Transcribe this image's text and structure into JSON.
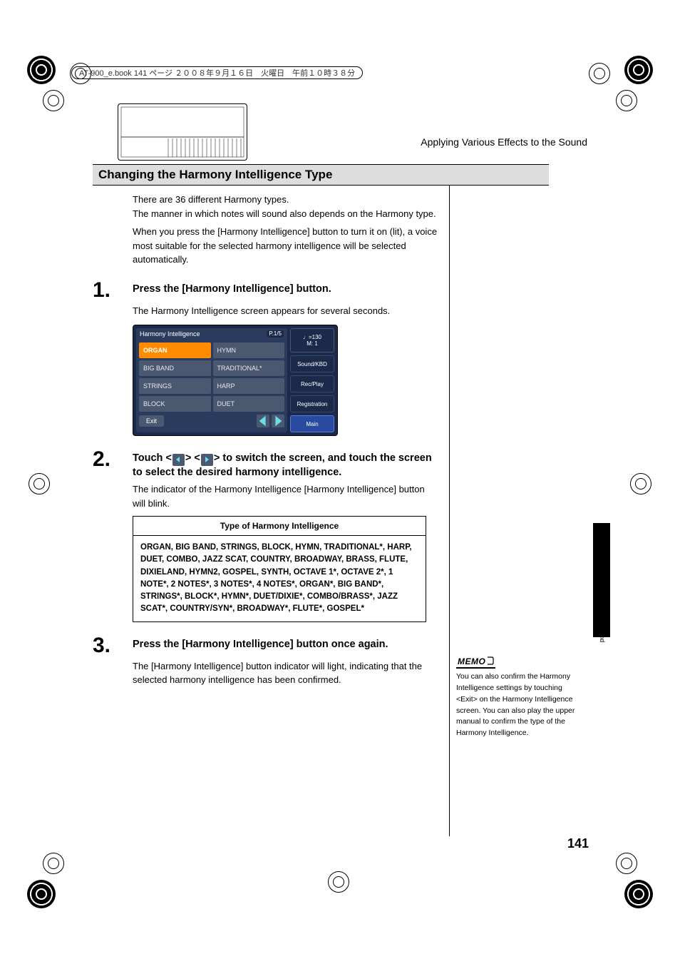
{
  "header": {
    "book_info": "AT-900_e.book  141 ページ  ２００８年９月１６日　火曜日　午前１０時３８分"
  },
  "chapter": "Applying Various Effects to the Sound",
  "section_title": "Changing the Harmony Intelligence Type",
  "intro": {
    "p1": "There are 36 different Harmony types.",
    "p2": "The manner in which notes will sound also depends on the Harmony type.",
    "p3": "When you press the [Harmony Intelligence] button to turn it on (lit), a voice most suitable for the selected harmony intelligence will be selected automatically."
  },
  "steps": {
    "s1": {
      "num": "1.",
      "head": "Press the [Harmony Intelligence] button.",
      "body": "The Harmony Intelligence screen appears for several seconds."
    },
    "s2": {
      "num": "2.",
      "head_pre": "Touch <",
      "head_mid": "> <",
      "head_post": "> to switch the screen, and touch the screen to select the desired harmony intelligence.",
      "body": "The indicator of the Harmony Intelligence [Harmony Intelligence] button will blink."
    },
    "s3": {
      "num": "3.",
      "head": "Press the [Harmony Intelligence] button once again.",
      "body": "The [Harmony Intelligence] button indicator will light, indicating that the selected harmony intelligence has been confirmed."
    }
  },
  "screen": {
    "title": "Harmony Intelligence",
    "page": "P.1/5",
    "cells": [
      "ORGAN",
      "HYMN",
      "BIG BAND",
      "TRADITIONAL*",
      "STRINGS",
      "HARP",
      "BLOCK",
      "DUET"
    ],
    "selected_index": 0,
    "exit": "Exit",
    "tempo_top": "♩=130",
    "tempo_bot": "M:     1",
    "side": [
      "Sound/KBD",
      "Rec/Play",
      "Registration",
      "Main"
    ]
  },
  "table": {
    "header": "Type of Harmony Intelligence",
    "body": "ORGAN, BIG BAND, STRINGS, BLOCK, HYMN, TRADITIONAL*, HARP, DUET, COMBO, JAZZ SCAT, COUNTRY, BROADWAY, BRASS, FLUTE, DIXIELAND, HYMN2, GOSPEL, SYNTH, OCTAVE 1*, OCTAVE 2*, 1 NOTE*, 2 NOTES*, 3 NOTES*, 4 NOTES*, ORGAN*, BIG BAND*, STRINGS*, BLOCK*, HYMN*, DUET/DIXIE*, COMBO/BRASS*, JAZZ SCAT*, COUNTRY/SYN*, BROADWAY*, FLUTE*, GOSPEL*"
  },
  "memo": {
    "label": "MEMO",
    "text": "You can also confirm the Harmony Intelligence settings by touching <Exit> on the Harmony Intelligence screen. You can also play the upper manual to confirm the type of the Harmony Intelligence."
  },
  "side_caption": "Applying Various Effects to the Sound",
  "page_number": "141"
}
